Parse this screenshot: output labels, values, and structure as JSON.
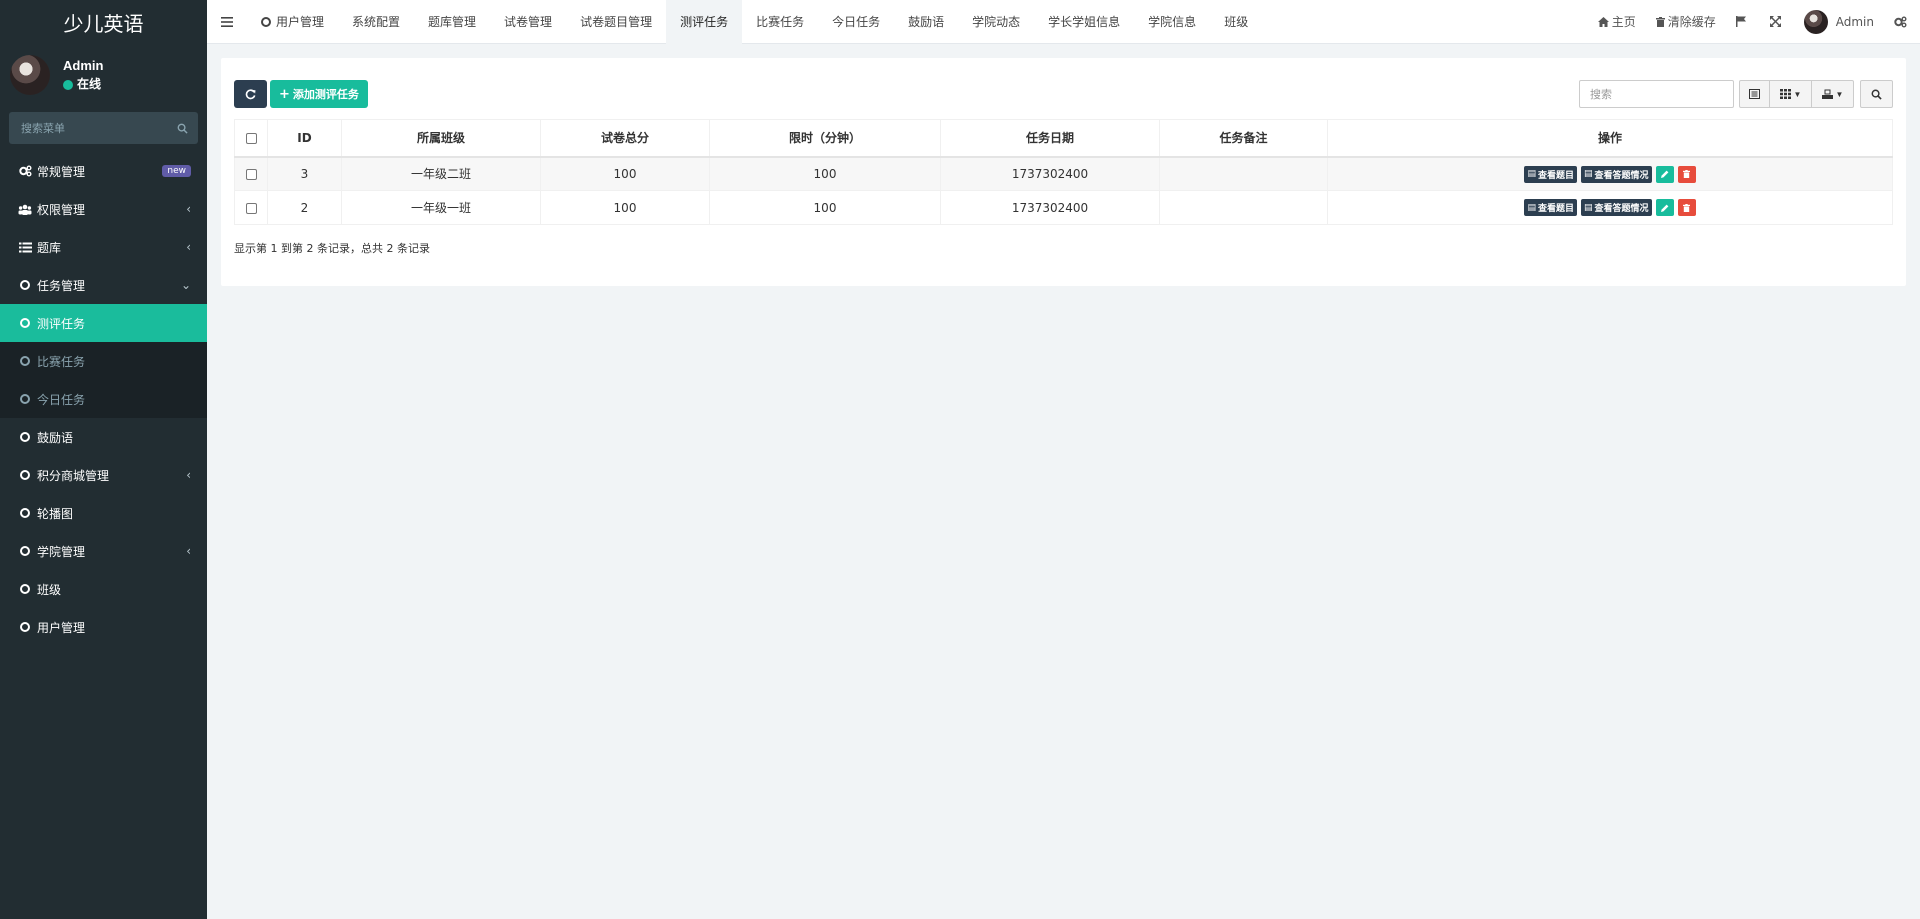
{
  "app": {
    "title": "少儿英语"
  },
  "user": {
    "name": "Admin",
    "status": "在线"
  },
  "sidebar": {
    "search_placeholder": "搜索菜单",
    "items": [
      {
        "label": "常规管理",
        "icon": "cogs-icon",
        "badge": "new"
      },
      {
        "label": "权限管理",
        "icon": "group-icon"
      },
      {
        "label": "题库",
        "icon": "list-icon"
      },
      {
        "label": "任务管理",
        "icon": "circle-o-icon"
      },
      {
        "label": "测评任务",
        "icon": "circle-o-icon"
      },
      {
        "label": "比赛任务",
        "icon": "circle-o-icon"
      },
      {
        "label": "今日任务",
        "icon": "circle-o-icon"
      },
      {
        "label": "鼓励语",
        "icon": "circle-o-icon"
      },
      {
        "label": "积分商城管理",
        "icon": "circle-o-icon"
      },
      {
        "label": "轮播图",
        "icon": "circle-o-icon"
      },
      {
        "label": "学院管理",
        "icon": "circle-o-icon"
      },
      {
        "label": "班级",
        "icon": "circle-o-icon"
      },
      {
        "label": "用户管理",
        "icon": "circle-o-icon"
      }
    ]
  },
  "header": {
    "tabs": [
      "用户管理",
      "系统配置",
      "题库管理",
      "试卷管理",
      "试卷题目管理",
      "测评任务",
      "比赛任务",
      "今日任务",
      "鼓励语",
      "学院动态",
      "学长学姐信息",
      "学院信息",
      "班级"
    ],
    "home_label": "主页",
    "clear_cache_label": "清除缓存",
    "user_name": "Admin"
  },
  "toolbar": {
    "add_label": "添加测评任务",
    "search_placeholder": "搜索"
  },
  "table": {
    "columns": [
      "ID",
      "所属班级",
      "试卷总分",
      "限时（分钟）",
      "任务日期",
      "任务备注",
      "操作"
    ],
    "rows": [
      {
        "id": "3",
        "class": "一年级二班",
        "total": "100",
        "limit": "100",
        "date": "1737302400",
        "note": ""
      },
      {
        "id": "2",
        "class": "一年级一班",
        "total": "100",
        "limit": "100",
        "date": "1737302400",
        "note": ""
      }
    ],
    "op_view_questions": "查看题目",
    "op_view_answers": "查看答题情况"
  },
  "pagination": {
    "info": "显示第 1 到第 2 条记录，总共 2 条记录"
  },
  "colors": {
    "accent": "#18bc9c",
    "dark": "#2c3e50",
    "danger": "#e74c3c",
    "sidebar": "#222d32"
  }
}
